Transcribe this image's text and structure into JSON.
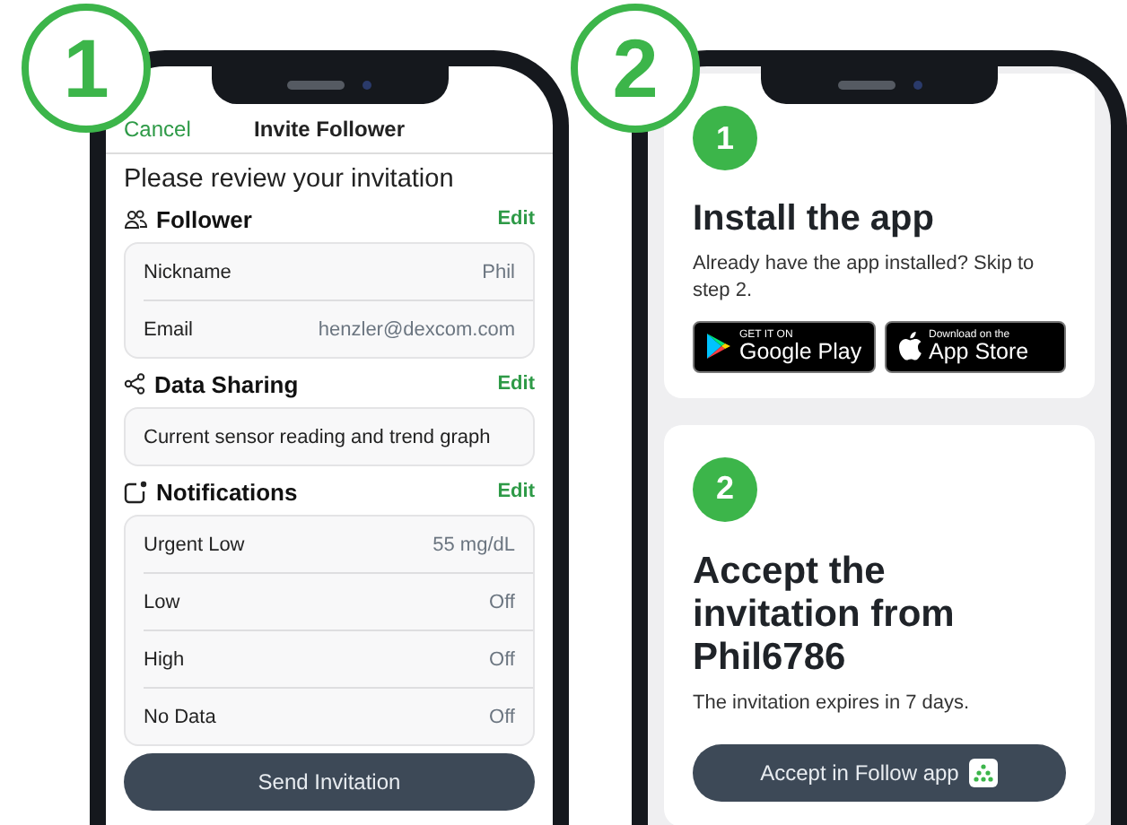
{
  "left_phone": {
    "step_badge": "1",
    "nav": {
      "cancel": "Cancel",
      "title": "Invite Follower"
    },
    "heading": "Please review your invitation",
    "sections": [
      {
        "kind": "people",
        "title": "Follower",
        "action": "Edit",
        "rows": [
          {
            "label": "Nickname",
            "value": "Phil"
          },
          {
            "label": "Email",
            "value": "henzler@dexcom.com"
          }
        ]
      },
      {
        "kind": "share",
        "title": "Data Sharing",
        "action": "Edit",
        "rows": [
          {
            "label": "Current sensor reading and trend graph"
          }
        ]
      },
      {
        "kind": "notification",
        "title": "Notifications",
        "action": "Edit",
        "rows": [
          {
            "label": "Urgent Low",
            "value": "55 mg/dL"
          },
          {
            "label": "Low",
            "value": "Off"
          },
          {
            "label": "High",
            "value": "Off"
          },
          {
            "label": "No Data",
            "value": "Off"
          }
        ]
      }
    ],
    "button": "Send Invitation"
  },
  "right_phone": {
    "step_badge": "2",
    "steps": [
      {
        "number": "1",
        "title": "Install the app",
        "text": "Already have the app installed? Skip to step 2.",
        "stores": [
          {
            "kind": "google",
            "small": "GET IT ON",
            "big": "Google Play"
          },
          {
            "kind": "apple",
            "small": "Download on the",
            "big": "App Store"
          }
        ]
      },
      {
        "number": "2",
        "title": "Accept the invitation from Phil6786",
        "text": "The invitation expires in 7 days.",
        "button": "Accept in Follow app"
      }
    ]
  }
}
